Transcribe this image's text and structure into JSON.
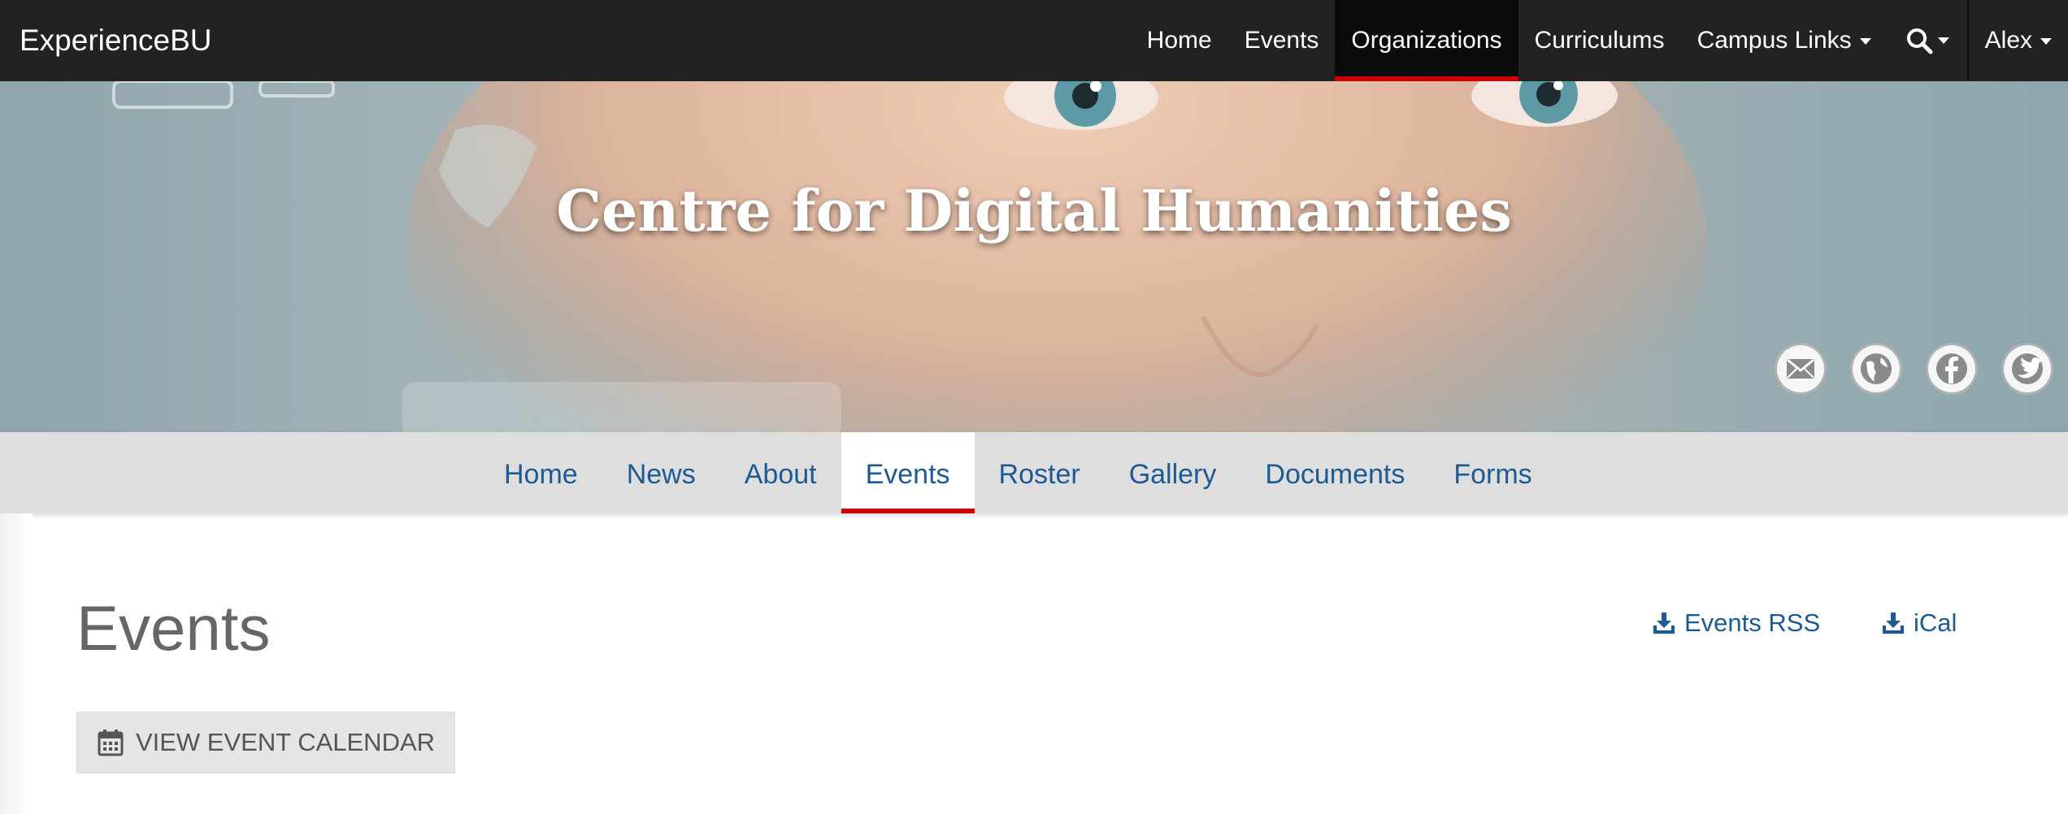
{
  "topbar": {
    "brand": "ExperienceBU",
    "nav": [
      {
        "label": "Home"
      },
      {
        "label": "Events"
      },
      {
        "label": "Organizations",
        "active": true
      },
      {
        "label": "Curriculums"
      },
      {
        "label": "Campus Links",
        "dropdown": true
      }
    ],
    "search_icon": "search-icon",
    "user": "Alex"
  },
  "hero": {
    "title": "Centre for Digital Humanities",
    "social": [
      "email-icon",
      "globe-icon",
      "facebook-icon",
      "twitter-icon"
    ]
  },
  "subnav": {
    "tabs": [
      "Home",
      "News",
      "About",
      "Events",
      "Roster",
      "Gallery",
      "Documents",
      "Forms"
    ],
    "active": "Events"
  },
  "content": {
    "title": "Events",
    "rss_label": "Events RSS",
    "ical_label": "iCal",
    "calendar_button": "VIEW EVENT CALENDAR"
  },
  "colors": {
    "navbar": "#222222",
    "accent_red": "#cc0000",
    "link_blue": "#1d5a93",
    "subnav_bg": "#dedede"
  }
}
